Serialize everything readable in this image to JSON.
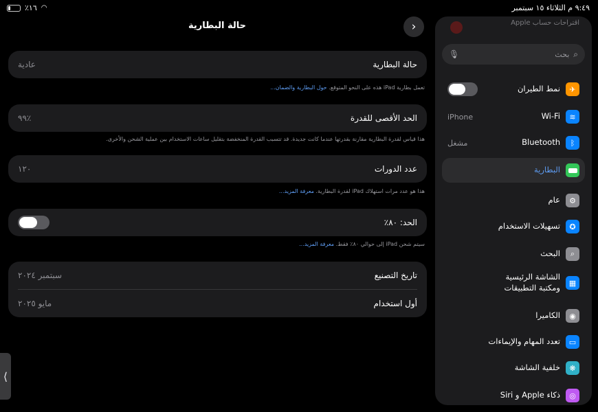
{
  "status": {
    "time": "٩:٤٩ م",
    "date": "الثلاثاء ١٥ سبتمبر",
    "battery": "٪١٦"
  },
  "main": {
    "title": "حالة البطارية",
    "back_icon": "chevron-right-icon",
    "health": {
      "label": "حالة البطارية",
      "value": "عادية"
    },
    "health_note": "تعمل بطارية iPad هذه على النحو المتوقع.",
    "health_link": "حول البطارية والضمان...",
    "max_capacity": {
      "label": "الحد الأقصى للقدرة",
      "value": "٪٩٩"
    },
    "max_capacity_note": "هذا قياس لقدرة البطارية مقارنة بقدرتها عندما كانت جديدة. قد تتسبب القدرة المنخفضة بتقليل ساعات الاستخدام بين عملية الشحن والأخرى.",
    "cycle_count": {
      "label": "عدد الدورات",
      "value": "١٢٠"
    },
    "cycle_note": "هذا هو عدد مرات استهلاك iPad لقدرة البطارية.",
    "cycle_link": "معرفة المزيد...",
    "limit": {
      "label": "الحد: ٨٠٪",
      "on": false
    },
    "limit_note": "سيتم شحن iPad إلى حوالي ٨٠٪ فقط.",
    "limit_link": "معرفة المزيد...",
    "manufacture": {
      "label": "تاريخ التصنيع",
      "value": "سبتمبر ٢٠٢٤"
    },
    "first_use": {
      "label": "أول استخدام",
      "value": "مايو ٢٠٢٥"
    }
  },
  "sidebar": {
    "account_peek": "اقتراحات حساب Apple",
    "search_placeholder": "بحث",
    "items": [
      {
        "label": "نمط الطيران",
        "icon": "airplane-icon",
        "color": "#ff9500",
        "glyph": "✈",
        "toggle": true
      },
      {
        "label": "Wi-Fi",
        "icon": "wifi-icon",
        "color": "#0a84ff",
        "glyph": "≋",
        "value": "iPhone"
      },
      {
        "label": "Bluetooth",
        "icon": "bluetooth-icon",
        "color": "#0a84ff",
        "glyph": "ᛒ",
        "value": "مشغل"
      },
      {
        "label": "البطارية",
        "icon": "battery-icon",
        "color": "#34c759",
        "glyph": ""
      },
      {
        "label": "عام",
        "icon": "gear-icon",
        "color": "#8e8e93",
        "glyph": "⚙"
      },
      {
        "label": "تسهيلات الاستخدام",
        "icon": "accessibility-icon",
        "color": "#0a84ff",
        "glyph": "✪"
      },
      {
        "label": "البحث",
        "icon": "search-icon",
        "color": "#8e8e93",
        "glyph": "⌕"
      },
      {
        "label": "الشاشة الرئيسية\nومكتبة التطبيقات",
        "icon": "home-screen-icon",
        "color": "#0a84ff",
        "glyph": "▦"
      },
      {
        "label": "الكاميرا",
        "icon": "camera-icon",
        "color": "#8e8e93",
        "glyph": "◉"
      },
      {
        "label": "تعدد المهام والإيماءات",
        "icon": "multitasking-icon",
        "color": "#0a84ff",
        "glyph": "▭"
      },
      {
        "label": "خلفية الشاشة",
        "icon": "wallpaper-icon",
        "color": "#30b0c7",
        "glyph": "❋"
      },
      {
        "label": "ذكاء Apple و Siri",
        "icon": "siri-icon",
        "color": "#bf5af2",
        "glyph": "◎"
      }
    ]
  }
}
